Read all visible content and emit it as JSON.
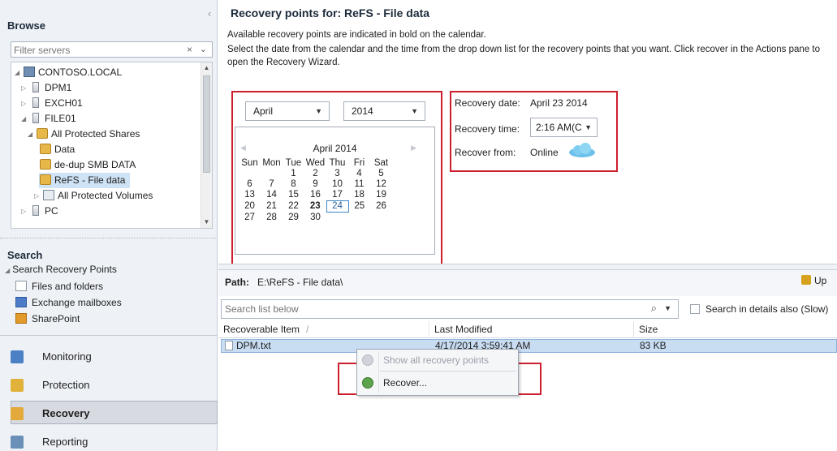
{
  "browse": {
    "title": "Browse",
    "filter_placeholder": "Filter servers",
    "clear_glyph": "×",
    "dropdown_glyph": "⌄",
    "collapse_glyph": "‹",
    "tree": [
      {
        "label": "CONTOSO.LOCAL",
        "icon": "domain-icon"
      },
      {
        "label": "DPM1",
        "icon": "server-icon"
      },
      {
        "label": "EXCH01",
        "icon": "server-icon"
      },
      {
        "label": "FILE01",
        "icon": "server-icon"
      },
      {
        "label": "All Protected Shares",
        "icon": "share-group-icon"
      },
      {
        "label": "Data",
        "icon": "share-icon"
      },
      {
        "label": "de-dup SMB DATA",
        "icon": "share-icon"
      },
      {
        "label": "ReFS - File data",
        "icon": "share-icon",
        "selected": true
      },
      {
        "label": "All Protected Volumes",
        "icon": "volume-group-icon"
      },
      {
        "label": "PC",
        "icon": "server-icon"
      }
    ]
  },
  "search": {
    "title": "Search",
    "group": "Search Recovery Points",
    "items": [
      {
        "label": "Files and folders",
        "icon": "file-icon"
      },
      {
        "label": "Exchange mailboxes",
        "icon": "mailbox-icon"
      },
      {
        "label": "SharePoint",
        "icon": "sharepoint-icon"
      }
    ]
  },
  "workspaces": [
    {
      "label": "Monitoring",
      "icon": "monitoring-icon"
    },
    {
      "label": "Protection",
      "icon": "protection-icon"
    },
    {
      "label": "Recovery",
      "icon": "recovery-icon",
      "active": true
    },
    {
      "label": "Reporting",
      "icon": "reporting-icon"
    }
  ],
  "main": {
    "title": "Recovery points for:  ReFS - File data",
    "info1": "Available recovery points are indicated in bold on the calendar.",
    "info2": "Select the date from the calendar and the time from the drop down list for the recovery points that you want. Click recover in the Actions pane to open the Recovery Wizard.",
    "month_select": "April",
    "year_select": "2014",
    "calendar": {
      "header": "April 2014",
      "weekdays": [
        "Sun",
        "Mon",
        "Tue",
        "Wed",
        "Thu",
        "Fri",
        "Sat"
      ],
      "weeks": [
        [
          "",
          "",
          "1",
          "2",
          "3",
          "4",
          "5"
        ],
        [
          "6",
          "7",
          "8",
          "9",
          "10",
          "11",
          "12"
        ],
        [
          "13",
          "14",
          "15",
          "16",
          "17",
          "18",
          "19"
        ],
        [
          "20",
          "21",
          "22",
          "23",
          "24",
          "25",
          "26"
        ],
        [
          "27",
          "28",
          "29",
          "30",
          "",
          "",
          ""
        ]
      ],
      "bold_dates": [
        "23"
      ],
      "today": "24"
    },
    "recovery_date_label": "Recovery date:",
    "recovery_date_value": "April 23 2014",
    "recovery_time_label": "Recovery time:",
    "recovery_time_value": "2:16 AM(C",
    "recover_from_label": "Recover from:",
    "recover_from_value": "Online",
    "path_label": "Path:",
    "path_value": "E:\\ReFS - File data\\",
    "up_label": "Up",
    "search_list_placeholder": "Search list below",
    "search_details_label": "Search in details also (Slow)",
    "columns": [
      "Recoverable Item",
      "Last Modified",
      "Size"
    ],
    "rows": [
      {
        "name": "DPM.txt",
        "modified": "4/17/2014 3:59:41 AM",
        "size": "83 KB"
      }
    ],
    "context_menu": [
      "Show all recovery points",
      "Recover..."
    ]
  },
  "colors": {
    "highlight_box": "#cc1f2d",
    "selection": "#c8dcf2",
    "accent": "#3d86c9"
  }
}
